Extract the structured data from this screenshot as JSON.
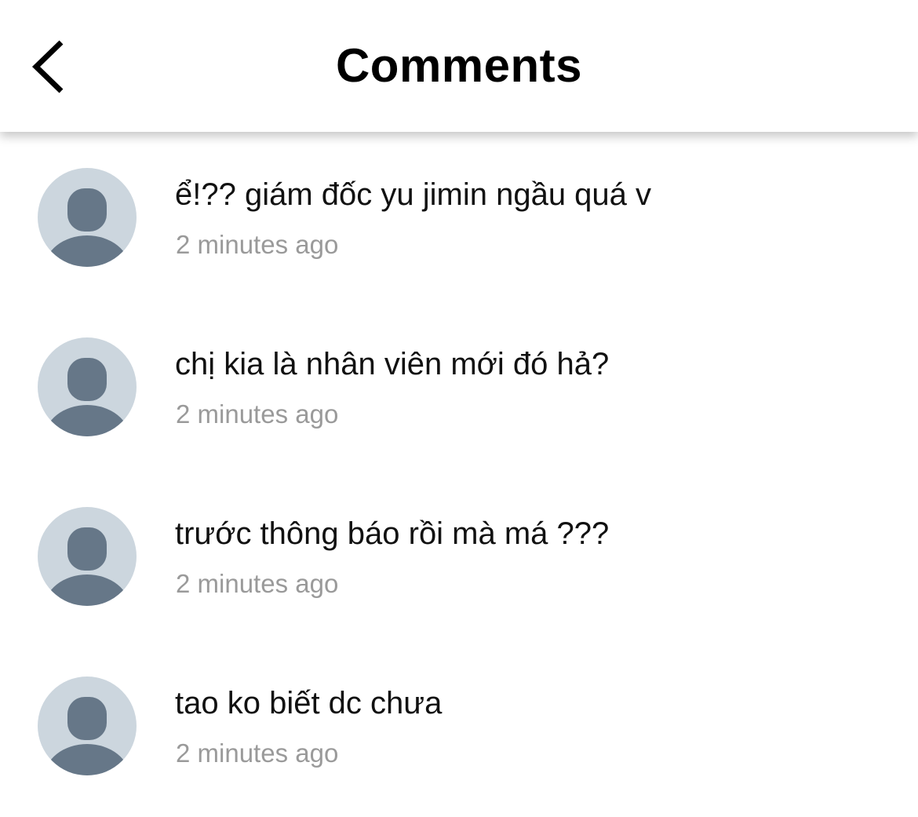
{
  "header": {
    "title": "Comments",
    "back_icon": "chevron-left-icon"
  },
  "colors": {
    "avatar_background": "#ccd6de",
    "avatar_silhouette": "#667788",
    "timestamp_text": "#9a9a9a"
  },
  "comments": [
    {
      "text": "ể!?? giám đốc yu jimin ngầu quá v",
      "time": "2 minutes ago",
      "avatar_icon": "default-user-icon"
    },
    {
      "text": "chị kia là nhân viên mới đó hả?",
      "time": "2 minutes ago",
      "avatar_icon": "default-user-icon"
    },
    {
      "text": "trước thông báo rồi mà má ???",
      "time": "2 minutes ago",
      "avatar_icon": "default-user-icon"
    },
    {
      "text": "tao ko biết dc chưa",
      "time": "2 minutes ago",
      "avatar_icon": "default-user-icon"
    }
  ]
}
